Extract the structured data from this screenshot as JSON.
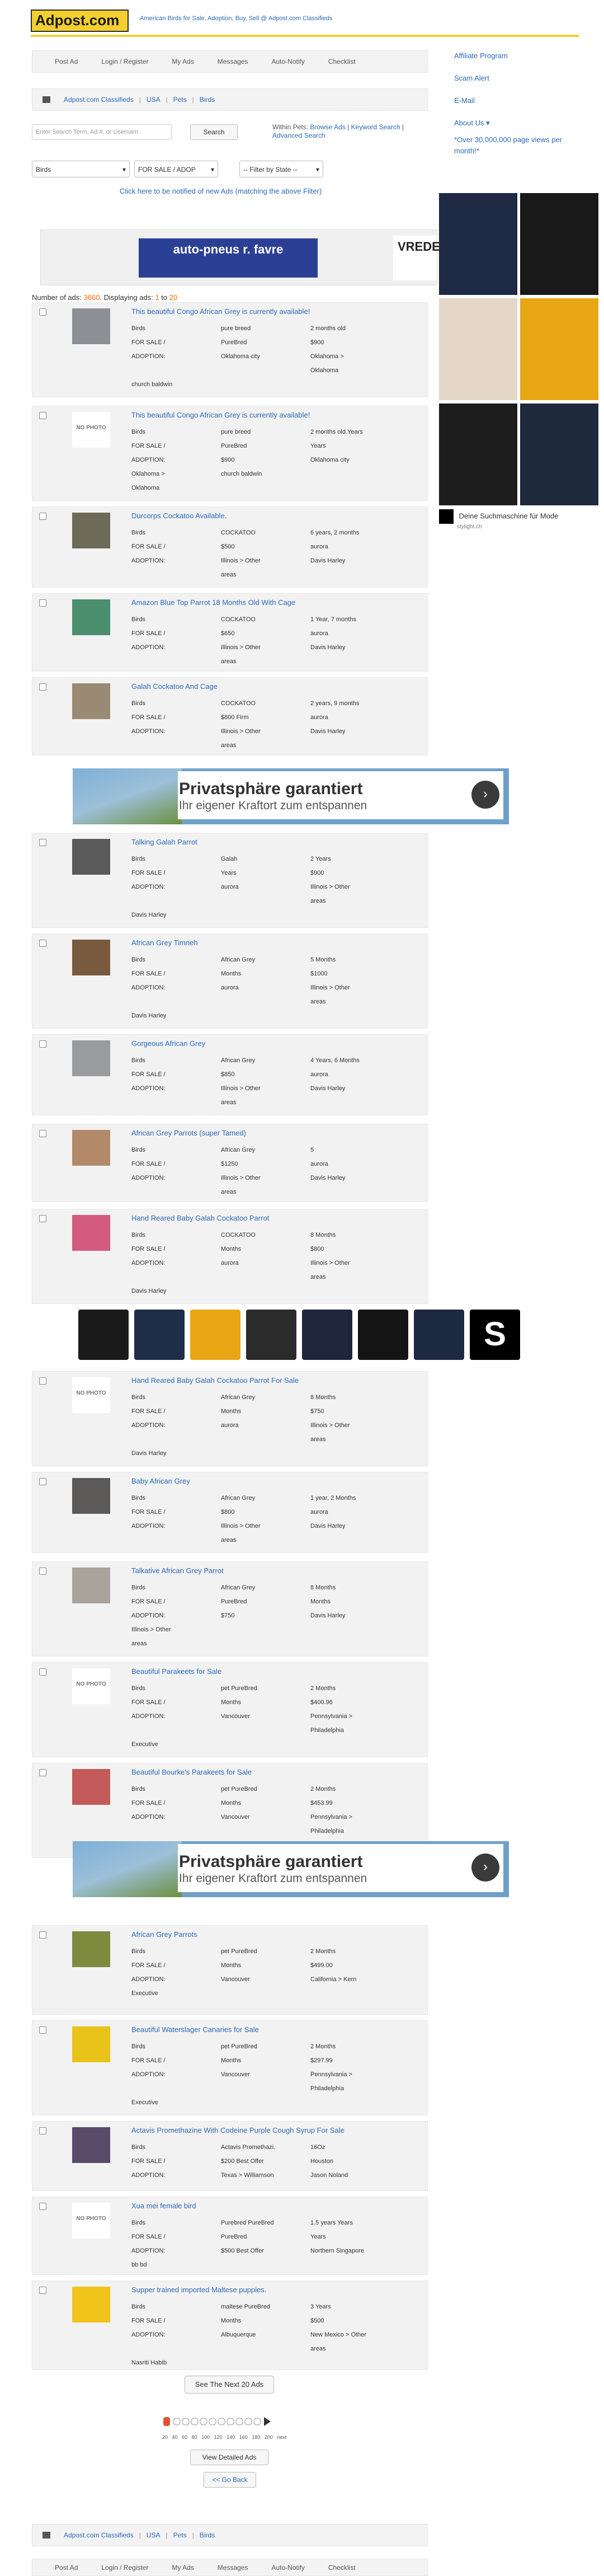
{
  "header": {
    "logo": "Adpost.com",
    "tagline": "American Birds for Sale, Adoption, Buy, Sell @ Adpost.com Classifieds"
  },
  "nav": [
    "Post Ad",
    "Login / Register",
    "My Ads",
    "Messages",
    "Auto-Notify",
    "Checklist"
  ],
  "breadcrumb": [
    "Adpost.com Classifieds",
    "USA",
    "Pets",
    "Birds"
  ],
  "search": {
    "placeholder": "Enter Search Term, Ad #, or Usernam",
    "button": "Search",
    "within_label": "Within Pets:",
    "browse_ads": "Browse Ads",
    "keyword_search": "Keyword Search",
    "advanced_search": "Advanced Search"
  },
  "filters": {
    "category": "Birds",
    "type": "FOR SALE / ADOP",
    "state": "-- Filter by State --"
  },
  "notify_link": "Click here to be notified of new Ads (matching the above Filter)",
  "sidebar": {
    "affiliate": "Affiliate Program",
    "scam": "Scam Alert",
    "email": "E-Mail",
    "about": "About Us",
    "views": "*Over 30,000,000 page views per month!*"
  },
  "ad_autopneus": "auto-pneus r. favre",
  "ad_vredestein": "VREDE",
  "side_ad_footer": "Deine Suchmaschine für Mode",
  "side_ad_sub": "stylight.ch",
  "count": {
    "label": "Number of ads:",
    "total": "3660",
    "display_label": "Displaying ads:",
    "from": "1",
    "to_label": "to",
    "to": "20"
  },
  "listings": [
    {
      "title": "This beautiful Congo African Grey is currently available!",
      "rows": [
        [
          "Birds",
          "pure breed",
          "2 months old"
        ],
        [
          "FOR SALE /",
          "PureBred",
          "$900"
        ],
        [
          "ADOPTION:",
          "Oklahoma city",
          "Oklahoma >"
        ],
        [
          "",
          "",
          "Oklahoma"
        ]
      ],
      "note": "church baldwin",
      "photo": true
    },
    {
      "title": "This beautiful Congo African Grey is currently available!",
      "rows": [
        [
          "Birds",
          "pure breed",
          "2 months old.Years"
        ],
        [
          "FOR SALE /",
          "PureBred",
          "Years"
        ],
        [
          "ADOPTION:",
          "$900",
          "Oklahoma city"
        ],
        [
          "Oklahoma >",
          "church baldwin",
          ""
        ]
      ],
      "note": "Oklahoma",
      "photo": false
    },
    {
      "title": "Durcorps Cockatoo Available.",
      "rows": [
        [
          "Birds",
          "COCKATOO",
          "6 years, 2 months"
        ],
        [
          "FOR SALE /",
          "$500",
          "aurora"
        ],
        [
          "ADOPTION:",
          "Illinois > Other",
          "Davis Harley"
        ],
        [
          "",
          "areas",
          ""
        ]
      ],
      "note": "",
      "photo": true
    },
    {
      "title": "Amazon Blue Top Parrot 18 Months Old With Cage",
      "rows": [
        [
          "Birds",
          "COCKATOO",
          "1 Year, 7 months"
        ],
        [
          "FOR SALE /",
          "$650",
          "aurora"
        ],
        [
          "ADOPTION:",
          "Illinois > Other",
          "Davis Harley"
        ],
        [
          "",
          "areas",
          ""
        ]
      ],
      "note": "",
      "photo": true
    },
    {
      "title": "Galah Cockatoo And Cage",
      "rows": [
        [
          "Birds",
          "COCKATOO",
          "2 years, 9 months"
        ],
        [
          "FOR SALE /",
          "$800 Firm",
          "aurora"
        ],
        [
          "ADOPTION:",
          "Illinois > Other",
          "Davis Harley"
        ],
        [
          "",
          "areas",
          ""
        ]
      ],
      "note": "",
      "photo": true
    },
    {
      "title": "Talking Galah Parrot",
      "rows": [
        [
          "Birds",
          "Galah",
          "2 Years"
        ],
        [
          "FOR SALE /",
          "Years",
          "$900"
        ],
        [
          "ADOPTION:",
          "aurora",
          "Illinois > Other"
        ],
        [
          "",
          "",
          "areas"
        ]
      ],
      "note": "Davis Harley",
      "photo": true
    },
    {
      "title": "African Grey Timneh",
      "rows": [
        [
          "Birds",
          "African Grey",
          "5 Months"
        ],
        [
          "FOR SALE /",
          "Months",
          "$1000"
        ],
        [
          "ADOPTION:",
          "aurora",
          "Illinois > Other"
        ],
        [
          "",
          "",
          "areas"
        ]
      ],
      "note": "Davis Harley",
      "photo": true
    },
    {
      "title": "Gorgeous African Grey",
      "rows": [
        [
          "Birds",
          "African Grey",
          "4 Years, 6 Months"
        ],
        [
          "FOR SALE /",
          "$850",
          "aurora"
        ],
        [
          "ADOPTION:",
          "Illinois > Other",
          "Davis Harley"
        ],
        [
          "",
          "areas",
          ""
        ]
      ],
      "note": "",
      "photo": true
    },
    {
      "title": "African Grey Parrots (super Tamed)",
      "rows": [
        [
          "Birds",
          "African Grey",
          "5"
        ],
        [
          "FOR SALE /",
          "$1250",
          "aurora"
        ],
        [
          "ADOPTION:",
          "Illinois > Other",
          "Davis Harley"
        ],
        [
          "",
          "areas",
          ""
        ]
      ],
      "note": "",
      "photo": true
    },
    {
      "title": "Hand Reared Baby Galah Cockatoo Parrot",
      "rows": [
        [
          "Birds",
          "COCKATOO",
          "8 Months"
        ],
        [
          "FOR SALE /",
          "Months",
          "$800"
        ],
        [
          "ADOPTION:",
          "aurora",
          "Illinois > Other"
        ],
        [
          "",
          "",
          "areas"
        ]
      ],
      "note": "Davis Harley",
      "photo": true
    },
    {
      "title": "Hand Reared Baby Galah Cockatoo Parrot For Sale",
      "rows": [
        [
          "Birds",
          "African Grey",
          "8 Months"
        ],
        [
          "FOR SALE /",
          "Months",
          "$750"
        ],
        [
          "ADOPTION:",
          "aurora",
          "Illinois > Other"
        ],
        [
          "",
          "",
          "areas"
        ]
      ],
      "note": "Davis Harley",
      "photo": false
    },
    {
      "title": "Baby African Grey",
      "rows": [
        [
          "Birds",
          "African Grey",
          "1 year, 2 Months"
        ],
        [
          "FOR SALE /",
          "$800",
          "aurora"
        ],
        [
          "ADOPTION:",
          "Illinois > Other",
          "Davis Harley"
        ],
        [
          "",
          "areas",
          ""
        ]
      ],
      "note": "",
      "photo": true
    },
    {
      "title": "Talkative African Grey Parrot",
      "rows": [
        [
          "Birds",
          "African Grey",
          "8 Months"
        ],
        [
          "FOR SALE /",
          "PureBred",
          "Months"
        ],
        [
          "ADOPTION:",
          "$750",
          "Davis Harley"
        ],
        [
          "Illinois > Other",
          "",
          ""
        ]
      ],
      "note": "areas",
      "photo": true
    },
    {
      "title": "Beautiful Parakeets for Sale",
      "rows": [
        [
          "Birds",
          "pet PureBred",
          "2 Months"
        ],
        [
          "FOR SALE /",
          "Months",
          "$400.96"
        ],
        [
          "ADOPTION:",
          "Vancouver",
          "Pennsylvania >"
        ],
        [
          "",
          "",
          "Philadelphia"
        ]
      ],
      "note": "Executive",
      "photo": false
    },
    {
      "title": "Beautiful Bourke's Parakeets for Sale",
      "rows": [
        [
          "Birds",
          "pet PureBred",
          "2 Months"
        ],
        [
          "FOR SALE /",
          "Months",
          "$453.99"
        ],
        [
          "ADOPTION:",
          "Vancouver",
          "Pennsylvania >"
        ],
        [
          "",
          "",
          "Philadelphia"
        ]
      ],
      "note": "Executive",
      "photo": true
    },
    {
      "title": "African Grey Parrots",
      "rows": [
        [
          "Birds",
          "pet PureBred",
          "2 Months"
        ],
        [
          "FOR SALE /",
          "Months",
          "$499.00"
        ],
        [
          "ADOPTION:",
          "Vancouver",
          "California > Kern"
        ]
      ],
      "note": "Executive",
      "photo": true
    },
    {
      "title": "Beautiful Waterslager Canaries for Sale",
      "rows": [
        [
          "Birds",
          "pet PureBred",
          "2 Months"
        ],
        [
          "FOR SALE /",
          "Months",
          "$297.99"
        ],
        [
          "ADOPTION:",
          "Vancouver",
          "Pennsylvania >"
        ],
        [
          "",
          "",
          "Philadelphia"
        ]
      ],
      "note": "Executive",
      "photo": true
    },
    {
      "title": "Actavis Promethazine With Codeine Purple Cough Syrup For Sale",
      "rows": [
        [
          "Birds",
          "Actavis Promethazi.",
          "16Oz"
        ],
        [
          "FOR SALE /",
          "$200 Best Offer",
          "Houston"
        ],
        [
          "ADOPTION:",
          "Texas > Williamson",
          "Jason Noland"
        ]
      ],
      "note": "",
      "photo": true
    },
    {
      "title": "Xua mei female bird",
      "rows": [
        [
          "Birds",
          "Purebred PureBred",
          "1.5 years Years"
        ],
        [
          "FOR SALE /",
          "PureBred",
          "Years"
        ],
        [
          "ADOPTION:",
          "$500 Best Offer",
          "Northern Singapore"
        ]
      ],
      "note": "bb bd",
      "photo": false
    },
    {
      "title": "Supper trained imported Maltese puppies.",
      "rows": [
        [
          "Birds",
          "maltese PureBred",
          "3 Years"
        ],
        [
          "FOR SALE /",
          "Months",
          "$500"
        ],
        [
          "ADOPTION:",
          "Albuquerque",
          "New Mexico > Other"
        ],
        [
          "",
          "",
          "areas"
        ]
      ],
      "note": "Nasriti Habib",
      "photo": true
    }
  ],
  "bigad": {
    "title": "Privatsphäre garantiert",
    "sub": "Ihr eigener Kraftort zum entspannen"
  },
  "pagination": {
    "next_button": "See The Next 20 Ads",
    "pages": [
      "20",
      "40",
      "60",
      "80",
      "100",
      "120",
      "140",
      "160",
      "180",
      "200",
      "next"
    ],
    "detailed": "View Detailed Ads",
    "back": "<< Go Back"
  },
  "nophoto_label": "NO PHOTO"
}
